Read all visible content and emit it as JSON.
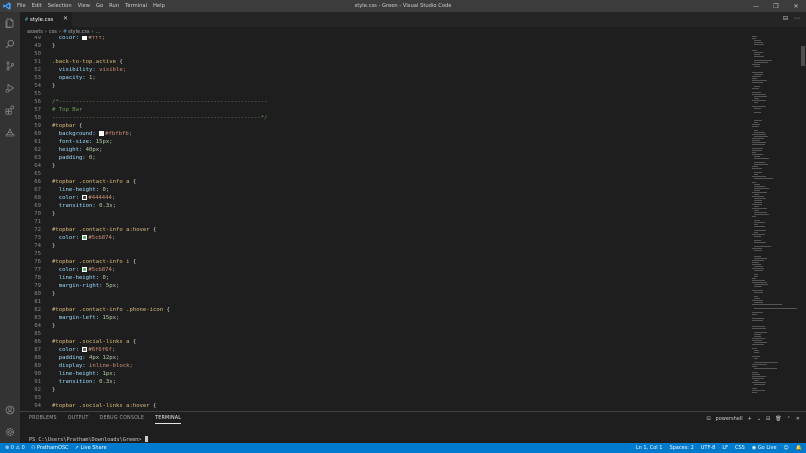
{
  "window": {
    "title": "style.css - Green - Visual Studio Code",
    "menu": [
      "File",
      "Edit",
      "Selection",
      "View",
      "Go",
      "Run",
      "Terminal",
      "Help"
    ],
    "controls": [
      "—",
      "❐",
      "✕"
    ]
  },
  "tab": {
    "icon": "#",
    "label": "style.css",
    "close": "✕"
  },
  "tab_actions": [
    "⊟",
    "⋯"
  ],
  "breadcrumb": {
    "parts": [
      "assets",
      "css"
    ],
    "file_icon": "#",
    "file": "style.css",
    "trail": "..."
  },
  "code": [
    {
      "n": "49",
      "tokens": [
        {
          "t": "  ",
          "c": "punc"
        },
        {
          "t": "color:",
          "c": "prop"
        },
        {
          "t": " ",
          "c": "punc"
        },
        {
          "sw": "#ffffff"
        },
        {
          "t": "#fff;",
          "c": "val"
        }
      ]
    },
    {
      "n": "49",
      "tokens": [
        {
          "t": "}",
          "c": "punc"
        }
      ]
    },
    {
      "n": "50",
      "tokens": []
    },
    {
      "n": "51",
      "tokens": [
        {
          "t": ".back-to-top.active",
          "c": "sel"
        },
        {
          "t": " {",
          "c": "punc"
        }
      ]
    },
    {
      "n": "52",
      "tokens": [
        {
          "t": "  visibility:",
          "c": "prop"
        },
        {
          "t": " visible;",
          "c": "val"
        }
      ]
    },
    {
      "n": "53",
      "tokens": [
        {
          "t": "  opacity:",
          "c": "prop"
        },
        {
          "t": " 1;",
          "c": "num"
        }
      ]
    },
    {
      "n": "54",
      "tokens": [
        {
          "t": "}",
          "c": "punc"
        }
      ]
    },
    {
      "n": "55",
      "tokens": []
    },
    {
      "n": "56",
      "tokens": [
        {
          "t": "/*--------------------------------------------------------------",
          "c": "cmt"
        }
      ]
    },
    {
      "n": "57",
      "tokens": [
        {
          "t": "# Top Bar",
          "c": "cmt"
        }
      ]
    },
    {
      "n": "58",
      "tokens": [
        {
          "t": "--------------------------------------------------------------*/",
          "c": "cmt"
        }
      ]
    },
    {
      "n": "59",
      "tokens": [
        {
          "t": "#topbar",
          "c": "sel"
        },
        {
          "t": " {",
          "c": "punc"
        }
      ]
    },
    {
      "n": "60",
      "tokens": [
        {
          "t": "  background:",
          "c": "prop"
        },
        {
          "t": " ",
          "c": "punc"
        },
        {
          "sw": "#fbfbfb"
        },
        {
          "t": "#fbfbfb;",
          "c": "val"
        }
      ]
    },
    {
      "n": "61",
      "tokens": [
        {
          "t": "  font-size:",
          "c": "prop"
        },
        {
          "t": " 15px;",
          "c": "num"
        }
      ]
    },
    {
      "n": "62",
      "tokens": [
        {
          "t": "  height:",
          "c": "prop"
        },
        {
          "t": " 40px;",
          "c": "num"
        }
      ]
    },
    {
      "n": "63",
      "tokens": [
        {
          "t": "  padding:",
          "c": "prop"
        },
        {
          "t": " 0;",
          "c": "num"
        }
      ]
    },
    {
      "n": "64",
      "tokens": [
        {
          "t": "}",
          "c": "punc"
        }
      ]
    },
    {
      "n": "65",
      "tokens": []
    },
    {
      "n": "66",
      "tokens": [
        {
          "t": "#topbar .contact-info a",
          "c": "sel"
        },
        {
          "t": " {",
          "c": "punc"
        }
      ]
    },
    {
      "n": "67",
      "tokens": [
        {
          "t": "  line-height:",
          "c": "prop"
        },
        {
          "t": " 0;",
          "c": "num"
        }
      ]
    },
    {
      "n": "68",
      "tokens": [
        {
          "t": "  color:",
          "c": "prop"
        },
        {
          "t": " ",
          "c": "punc"
        },
        {
          "sw": "#444444"
        },
        {
          "t": "#444444;",
          "c": "val"
        }
      ]
    },
    {
      "n": "69",
      "tokens": [
        {
          "t": "  transition:",
          "c": "prop"
        },
        {
          "t": " 0.3s;",
          "c": "num"
        }
      ]
    },
    {
      "n": "70",
      "tokens": [
        {
          "t": "}",
          "c": "punc"
        }
      ]
    },
    {
      "n": "71",
      "tokens": []
    },
    {
      "n": "72",
      "tokens": [
        {
          "t": "#topbar .contact-info a:hover",
          "c": "sel"
        },
        {
          "t": " {",
          "c": "punc"
        }
      ]
    },
    {
      "n": "73",
      "tokens": [
        {
          "t": "  color:",
          "c": "prop"
        },
        {
          "t": " ",
          "c": "punc"
        },
        {
          "sw": "#5cb874"
        },
        {
          "t": "#5cb874;",
          "c": "val"
        }
      ]
    },
    {
      "n": "74",
      "tokens": [
        {
          "t": "}",
          "c": "punc"
        }
      ]
    },
    {
      "n": "75",
      "tokens": []
    },
    {
      "n": "76",
      "tokens": [
        {
          "t": "#topbar .contact-info i",
          "c": "sel"
        },
        {
          "t": " {",
          "c": "punc"
        }
      ]
    },
    {
      "n": "77",
      "tokens": [
        {
          "t": "  color:",
          "c": "prop"
        },
        {
          "t": " ",
          "c": "punc"
        },
        {
          "sw": "#5cb874"
        },
        {
          "t": "#5cb874;",
          "c": "val"
        }
      ]
    },
    {
      "n": "78",
      "tokens": [
        {
          "t": "  line-height:",
          "c": "prop"
        },
        {
          "t": " 0;",
          "c": "num"
        }
      ]
    },
    {
      "n": "79",
      "tokens": [
        {
          "t": "  margin-right:",
          "c": "prop"
        },
        {
          "t": " 5px;",
          "c": "num"
        }
      ]
    },
    {
      "n": "80",
      "tokens": [
        {
          "t": "}",
          "c": "punc"
        }
      ]
    },
    {
      "n": "81",
      "tokens": []
    },
    {
      "n": "82",
      "tokens": [
        {
          "t": "#topbar .contact-info .phone-icon",
          "c": "sel"
        },
        {
          "t": " {",
          "c": "punc"
        }
      ]
    },
    {
      "n": "83",
      "tokens": [
        {
          "t": "  margin-left:",
          "c": "prop"
        },
        {
          "t": " 15px;",
          "c": "num"
        }
      ]
    },
    {
      "n": "84",
      "tokens": [
        {
          "t": "}",
          "c": "punc"
        }
      ]
    },
    {
      "n": "85",
      "tokens": []
    },
    {
      "n": "86",
      "tokens": [
        {
          "t": "#topbar .social-links a",
          "c": "sel"
        },
        {
          "t": " {",
          "c": "punc"
        }
      ]
    },
    {
      "n": "87",
      "tokens": [
        {
          "t": "  color:",
          "c": "prop"
        },
        {
          "t": " ",
          "c": "punc"
        },
        {
          "sw": "#6f6f6f"
        },
        {
          "t": "#6f6f6f;",
          "c": "val"
        }
      ]
    },
    {
      "n": "88",
      "tokens": [
        {
          "t": "  padding:",
          "c": "prop"
        },
        {
          "t": " 4px 12px;",
          "c": "num"
        }
      ]
    },
    {
      "n": "89",
      "tokens": [
        {
          "t": "  display:",
          "c": "prop"
        },
        {
          "t": " inline-block;",
          "c": "val"
        }
      ]
    },
    {
      "n": "90",
      "tokens": [
        {
          "t": "  line-height:",
          "c": "prop"
        },
        {
          "t": " 1px;",
          "c": "num"
        }
      ]
    },
    {
      "n": "91",
      "tokens": [
        {
          "t": "  transition:",
          "c": "prop"
        },
        {
          "t": " 0.3s;",
          "c": "num"
        }
      ]
    },
    {
      "n": "92",
      "tokens": [
        {
          "t": "}",
          "c": "punc"
        }
      ]
    },
    {
      "n": "93",
      "tokens": []
    },
    {
      "n": "94",
      "tokens": [
        {
          "t": "#topbar .social-links a:hover",
          "c": "sel"
        },
        {
          "t": " {",
          "c": "punc"
        }
      ]
    }
  ],
  "panel": {
    "tabs": [
      "PROBLEMS",
      "OUTPUT",
      "DEBUG CONSOLE",
      "TERMINAL"
    ],
    "active_tab": "TERMINAL",
    "shell": "powershell",
    "actions": [
      "+",
      "⌄",
      "⊟",
      "🗑",
      "⌃",
      "✕"
    ],
    "prompt": "PS C:\\Users\\Pratham\\Downloads\\Green> "
  },
  "status": {
    "errors": "0",
    "warnings": "0",
    "user": "PrathamOSC",
    "live_share": "Live Share",
    "position": "Ln 1, Col 1",
    "spaces": "Spaces: 2",
    "encoding": "UTF-8",
    "eol": "LF",
    "language": "CSS",
    "go_live": "Go Live"
  },
  "colors": {
    "accent": "#007acc",
    "titlebar": "#3c3c3c",
    "activitybar": "#333333",
    "editor_bg": "#1e1e1e"
  },
  "icons": {
    "activity": [
      "files-icon",
      "search-icon",
      "source-control-icon",
      "run-debug-icon",
      "extensions-icon",
      "remote-explorer-icon"
    ],
    "activity_bottom": [
      "account-icon",
      "settings-gear-icon"
    ]
  }
}
